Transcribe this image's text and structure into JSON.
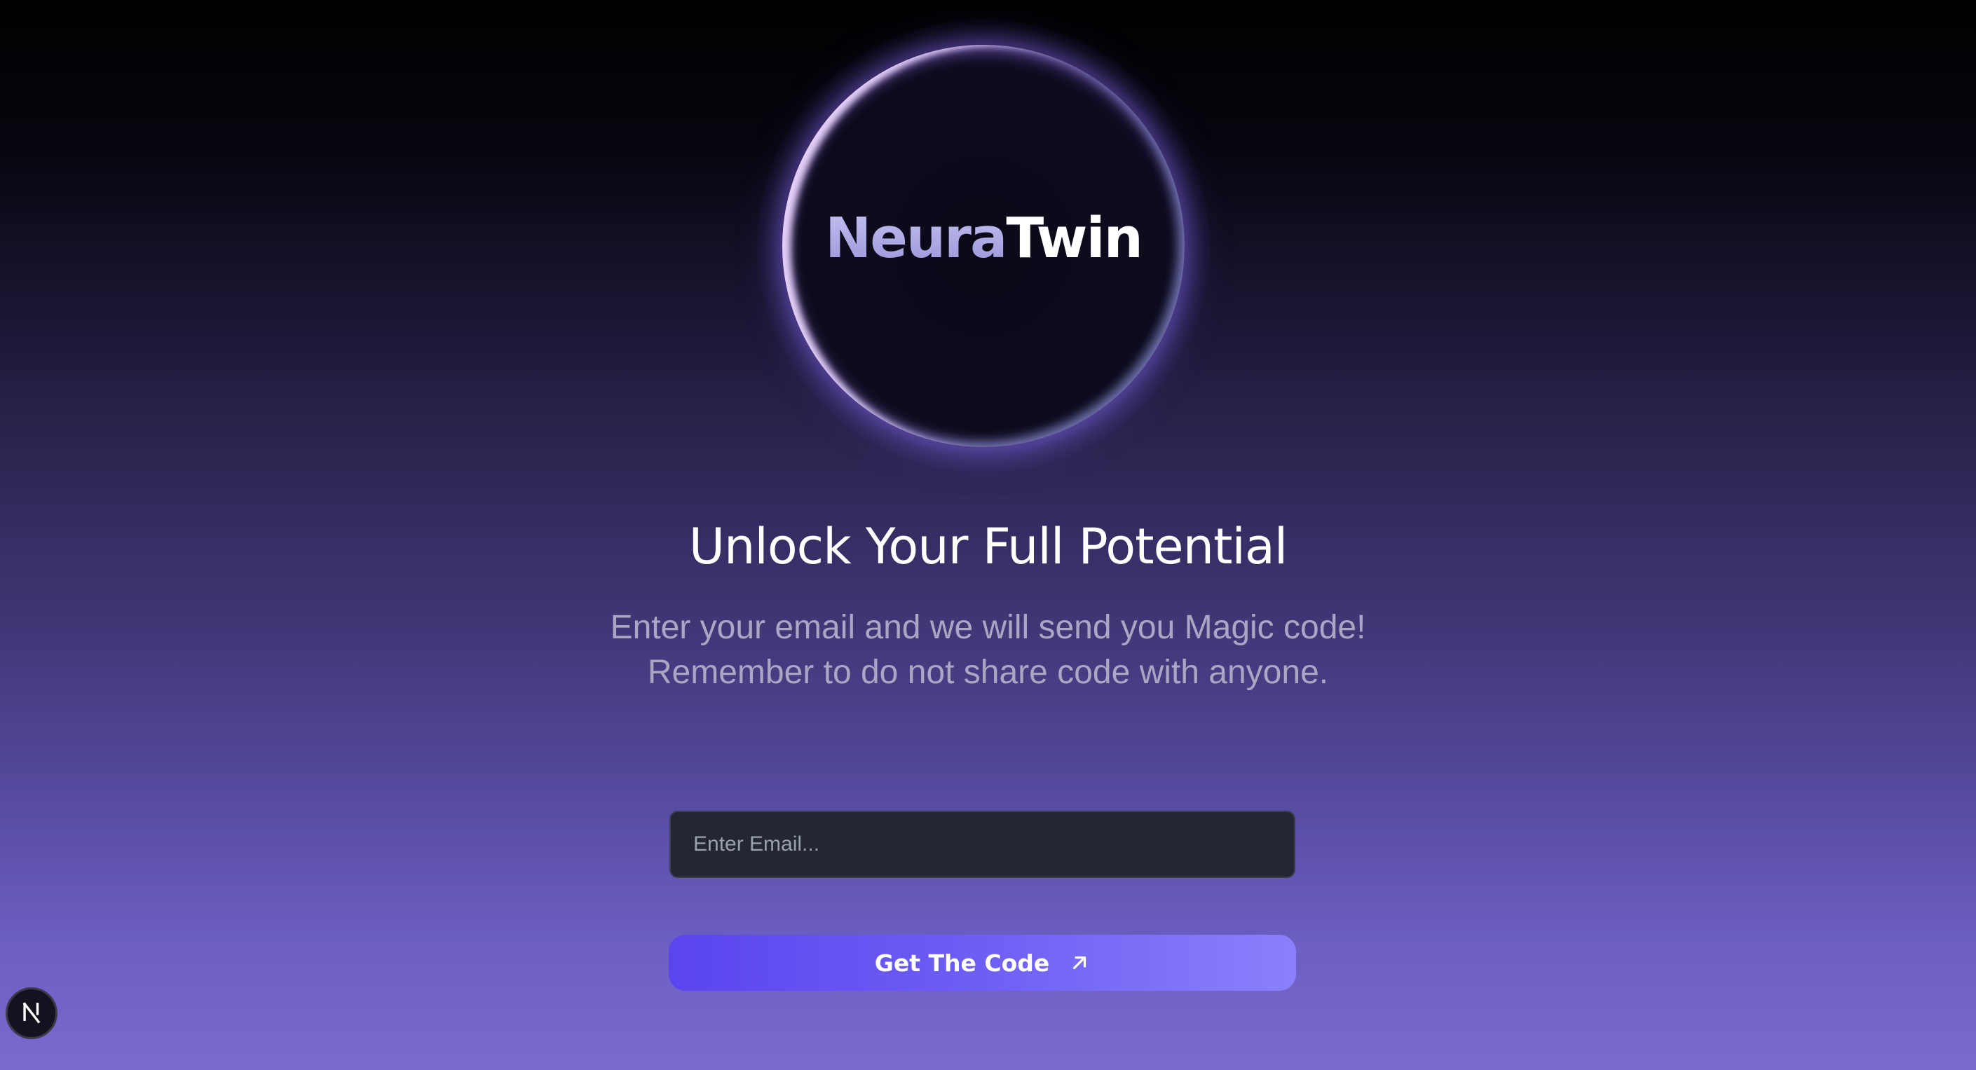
{
  "brand": {
    "name_part1": "Neura",
    "name_part2": "Twin"
  },
  "hero": {
    "title": "Unlock Your Full Potential",
    "subtitle_line1": "Enter your email and we will send you Magic code!",
    "subtitle_line2": "Remember to do not share code with anyone."
  },
  "form": {
    "email_value": "",
    "email_placeholder": "Enter Email...",
    "submit_label": "Get The Code",
    "submit_icon": "arrow-up-right-icon"
  },
  "badge": {
    "icon": "n-logo-icon"
  },
  "colors": {
    "button_start": "#5a45ef",
    "button_end": "#8a80fb",
    "input_bg": "#222733",
    "background_bottom": "#7a6ad0"
  }
}
